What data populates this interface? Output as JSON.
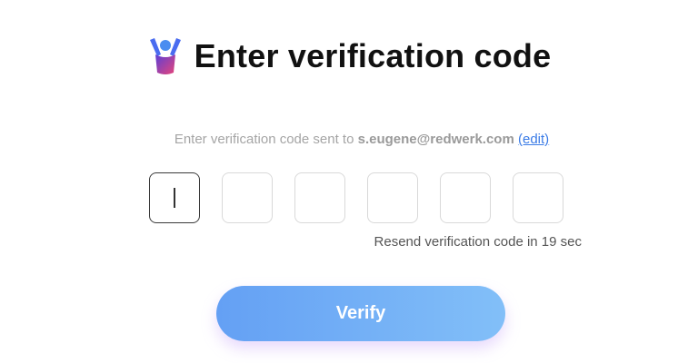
{
  "header": {
    "logo_icon": "person-raising-hands-logo-icon",
    "title": "Enter verification code"
  },
  "instruction": {
    "prefix": "Enter verification code sent to ",
    "email": "s.eugene@redwerk.com",
    "edit_label": "(edit)"
  },
  "code_inputs": [
    {
      "value": "",
      "active": true
    },
    {
      "value": "",
      "active": false
    },
    {
      "value": "",
      "active": false
    },
    {
      "value": "",
      "active": false
    },
    {
      "value": "",
      "active": false
    },
    {
      "value": "",
      "active": false
    }
  ],
  "resend": {
    "text": "Resend verification code in 19 sec"
  },
  "verify_button": {
    "label": "Verify"
  },
  "colors": {
    "link": "#3a7be6",
    "button_gradient_start": "#64a0f4",
    "button_gradient_end": "#82bff8",
    "logo_purple": "#8b2fc9",
    "logo_pink": "#e8457a",
    "logo_blue": "#4a6cf0"
  }
}
